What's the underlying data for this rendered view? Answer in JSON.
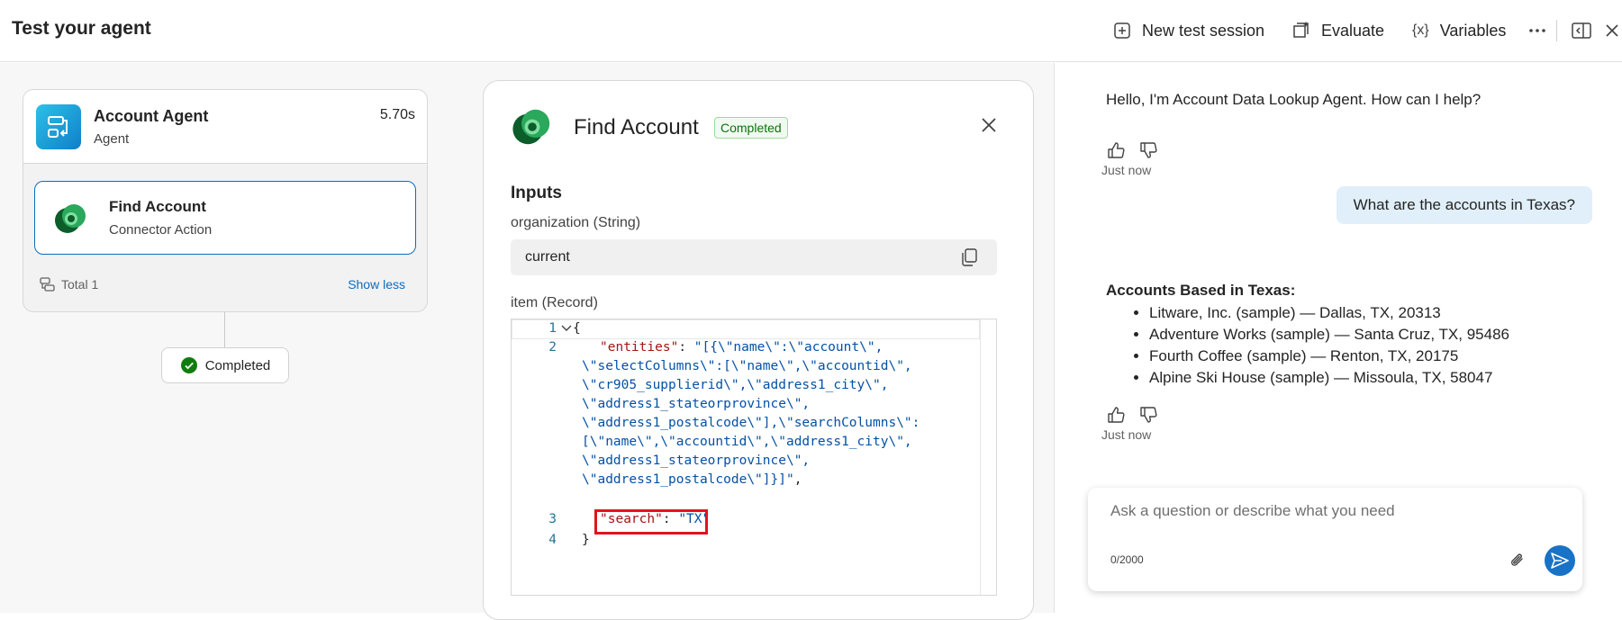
{
  "header": {
    "title": "Test your agent",
    "new_session": "New test session",
    "evaluate": "Evaluate",
    "variables": "Variables"
  },
  "agent_card": {
    "name": "Account Agent",
    "subtitle": "Agent",
    "duration": "5.70s",
    "action_name": "Find Account",
    "action_subtitle": "Connector Action",
    "total": "Total 1",
    "show_less": "Show less",
    "status": "Completed"
  },
  "detail": {
    "title": "Find Account",
    "badge": "Completed",
    "inputs_heading": "Inputs",
    "org_label": "organization (String)",
    "org_value": "current",
    "item_label": "item (Record)",
    "code_lines": {
      "n1": "1",
      "n2": "2",
      "n3": "3",
      "n4": "4",
      "l1": "{",
      "l2_key": "\"entities\"",
      "l2_sep": ": ",
      "l2_val": "\"[{\\\"name\\\":\\\"account\\\",",
      "w1": "\\\"selectColumns\\\":[\\\"name\\\",\\\"accountid\\\",",
      "w2": "\\\"cr905_supplierid\\\",\\\"address1_city\\\",",
      "w3": "\\\"address1_stateorprovince\\\",",
      "w4": "\\\"address1_postalcode\\\"],\\\"searchColumns\\\":",
      "w5": "[\\\"name\\\",\\\"accountid\\\",\\\"address1_city\\\",",
      "w6": "\\\"address1_stateorprovince\\\",",
      "w7": "\\\"address1_postalcode\\\"]}]\"",
      "w7_tail": ",",
      "l3_key": "\"search\"",
      "l3_sep": ": ",
      "l3_val": "\"TX\"",
      "l4": "}"
    }
  },
  "chat": {
    "bot_greeting": "Hello, I'm Account Data Lookup Agent. How can I help?",
    "timestamp_1": "Just now",
    "user_message": "What are the accounts in Texas?",
    "bot_title": "Accounts Based in Texas:",
    "bot_items": [
      "Litware, Inc. (sample) — Dallas, TX, 20313",
      "Adventure Works (sample) — Santa Cruz, TX, 95486",
      "Fourth Coffee (sample) — Renton, TX, 20175",
      "Alpine Ski House (sample) — Missoula, TX, 58047"
    ],
    "timestamp_2": "Just now",
    "input_placeholder": "Ask a question or describe what you need",
    "counter": "0/2000"
  },
  "colors": {
    "accent": "#0f6cbd",
    "success": "#107c10",
    "highlight_box": "#e0141e",
    "user_bubble": "#e0eff9"
  },
  "icons": [
    "plus-square-icon",
    "evaluate-icon",
    "variables-icon",
    "more-icon",
    "panel-icon",
    "close-icon",
    "thumbs-up-icon",
    "thumbs-down-icon",
    "copy-icon",
    "attach-icon",
    "send-icon"
  ]
}
